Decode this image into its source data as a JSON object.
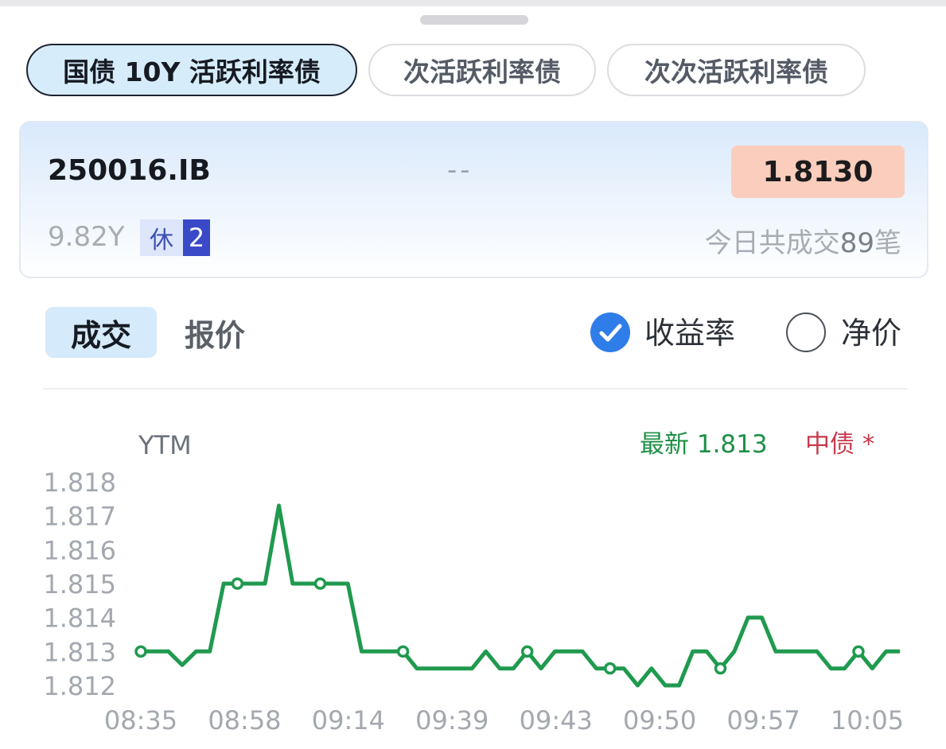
{
  "bond_tabs": [
    {
      "label": "国债 10Y 活跃利率债",
      "active": true
    },
    {
      "label": "次活跃利率债",
      "active": false
    },
    {
      "label": "次次活跃利率债",
      "active": false
    }
  ],
  "bond": {
    "code": "250016.IB",
    "change": "--",
    "price": "1.8130",
    "tenor": "9.82Y",
    "rest_label": "休",
    "rest_count": "2",
    "trades_prefix": "今日共成交",
    "trades_count": "89",
    "trades_suffix": "笔"
  },
  "view_tabs": {
    "deal": "成交",
    "quote": "报价"
  },
  "metric": {
    "yield_label": "收益率",
    "yield_selected": true,
    "clean_label": "净价",
    "clean_selected": false
  },
  "colors": {
    "line": "#1f9a4e",
    "accent": "#2f7de8",
    "price_badge": "#fbcdbd",
    "source": "#c8384b"
  },
  "chart_data": {
    "type": "line",
    "ylabel": "YTM",
    "latest_label": "最新 1.813",
    "source_label": "中债",
    "source_mark": "*",
    "y_ticks": [
      "1.818",
      "1.817",
      "1.816",
      "1.815",
      "1.814",
      "1.813",
      "1.812"
    ],
    "x_ticks": [
      "08:35",
      "08:58",
      "09:14",
      "09:39",
      "09:43",
      "09:50",
      "09:57",
      "10:05"
    ],
    "ylim": [
      1.812,
      1.818
    ],
    "series": [
      {
        "values": [
          1.813,
          1.813,
          1.813,
          1.8126,
          1.813,
          1.813,
          1.815,
          1.815,
          1.815,
          1.815,
          1.8173,
          1.815,
          1.815,
          1.815,
          1.815,
          1.815,
          1.813,
          1.813,
          1.813,
          1.813,
          1.8125,
          1.8125,
          1.8125,
          1.8125,
          1.8125,
          1.813,
          1.8125,
          1.8125,
          1.813,
          1.8125,
          1.813,
          1.813,
          1.813,
          1.8125,
          1.8125,
          1.8125,
          1.812,
          1.8125,
          1.812,
          1.812,
          1.813,
          1.813,
          1.8125,
          1.813,
          1.814,
          1.814,
          1.813,
          1.813,
          1.813,
          1.813,
          1.8125,
          1.8125,
          1.813,
          1.8125,
          1.813,
          1.813
        ],
        "markers": [
          0,
          7,
          13,
          19,
          28,
          34,
          42,
          52
        ]
      }
    ]
  }
}
